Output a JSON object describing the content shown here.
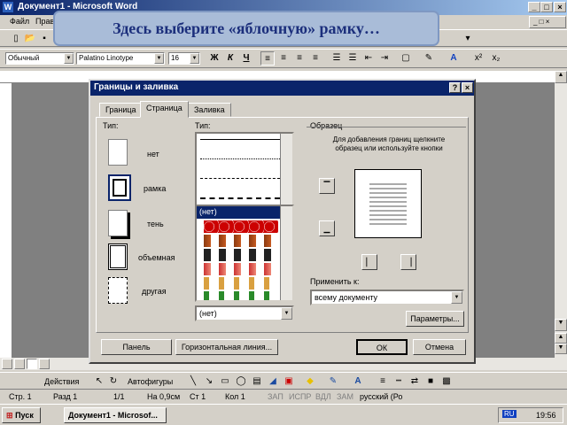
{
  "window": {
    "title": "Документ1 - Microsoft Word"
  },
  "menu": [
    "Файл",
    "Прав"
  ],
  "callout": "Здесь выберите «яблочную» рамку…",
  "format": {
    "style": "Обычный",
    "font": "Palatino Linotype",
    "size": "16",
    "bold": "Ж",
    "italic": "К",
    "underline": "Ч"
  },
  "dialog": {
    "title": "Границы и заливка",
    "help": "?",
    "close": "×",
    "tabs": [
      "Граница",
      "Страница",
      "Заливка"
    ],
    "type_label": "Тип:",
    "types": [
      "нет",
      "рамка",
      "тень",
      "объемная",
      "другая"
    ],
    "style_label": "Тип:",
    "art_label": "(нет)",
    "art_value": "(нет)",
    "sample_label": "Образец",
    "sample_hint": "Для добавления границ щелкните образец или используйте кнопки",
    "apply_label": "Применить к:",
    "apply_value": "всему документу",
    "options": "Параметры...",
    "toolbar": "Панель",
    "hline": "Горизонтальная линия...",
    "ok": "ОК",
    "cancel": "Отмена"
  },
  "drawing": {
    "actions": "Действия",
    "autoshapes": "Автофигуры"
  },
  "status": {
    "page": "Стр. 1",
    "section": "Разд 1",
    "pages": "1/1",
    "at": "На 0,9см",
    "line": "Ст 1",
    "col": "Кол 1",
    "rec": "ЗАП",
    "trk": "ИСПР",
    "ext": "ВДЛ",
    "ovr": "ЗАМ",
    "lang": "русский (Ро"
  },
  "taskbar": {
    "start": "Пуск",
    "task": "Документ1 - Microsof...",
    "lang": "RU",
    "time": "19:56"
  }
}
